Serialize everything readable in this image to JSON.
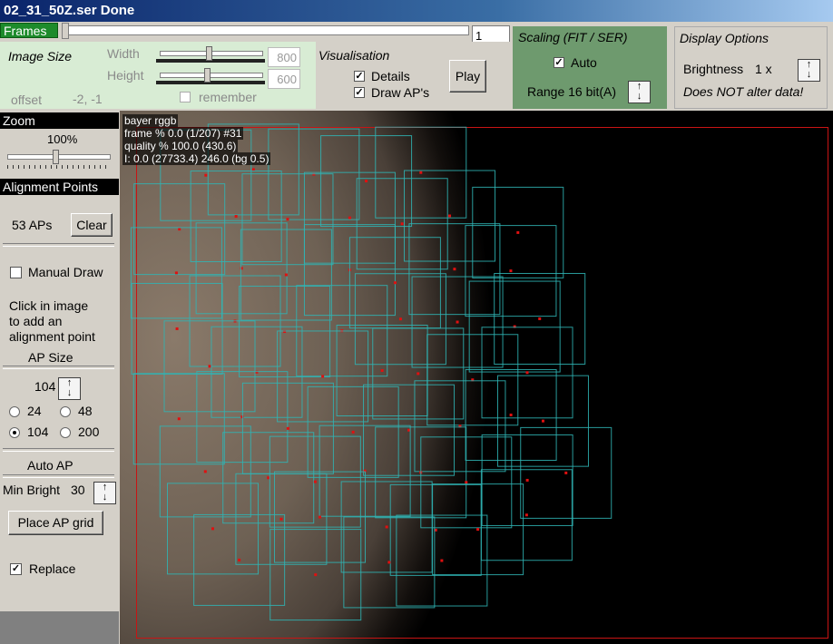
{
  "window": {
    "title": "02_31_50Z.ser   Done"
  },
  "frames": {
    "label": "Frames",
    "current": "1"
  },
  "image_size": {
    "title": "Image Size",
    "width_label": "Width",
    "height_label": "Height",
    "width_value": "800",
    "height_value": "600",
    "remember_label": "remember",
    "offset_label": "offset",
    "offset_value": "-2, -1"
  },
  "visualisation": {
    "title": "Visualisation",
    "details_label": "Details",
    "draw_aps_label": "Draw AP's",
    "play_label": "Play"
  },
  "scaling": {
    "title": "Scaling (FIT / SER)",
    "auto_label": "Auto",
    "range_label": "Range 16 bit(A)"
  },
  "display_options": {
    "title": "Display Options",
    "brightness_label": "Brightness",
    "brightness_value": "1 x",
    "note": "Does NOT alter data!"
  },
  "zoom": {
    "title": "Zoom",
    "value": "100%"
  },
  "alignment_points": {
    "title": "Alignment Points",
    "count_label": "53 APs",
    "clear_label": "Clear",
    "manual_draw_label": "Manual Draw",
    "hint": [
      "Click in image",
      "to add an",
      "alignment point"
    ],
    "ap_size_label": "AP Size",
    "ap_size_value": "104",
    "sizes": [
      "24",
      "48",
      "104",
      "200"
    ],
    "selected_size": "104",
    "auto_ap_label": "Auto AP",
    "min_bright_label": "Min Bright",
    "min_bright_value": "30",
    "place_grid_label": "Place AP grid",
    "replace_label": "Replace"
  },
  "image_info": {
    "line1": "bayer rggb",
    "line2": "frame % 0.0 (1/207) #31",
    "line3": "quality % 100.0  (430.6)",
    "line4": "I: 0.0 (27733.4) 246.0 (bg 0.5)"
  },
  "colors": {
    "ap_box": "#2fb5b5",
    "ap_dot": "#e01010",
    "frame_rect": "#c81414"
  }
}
